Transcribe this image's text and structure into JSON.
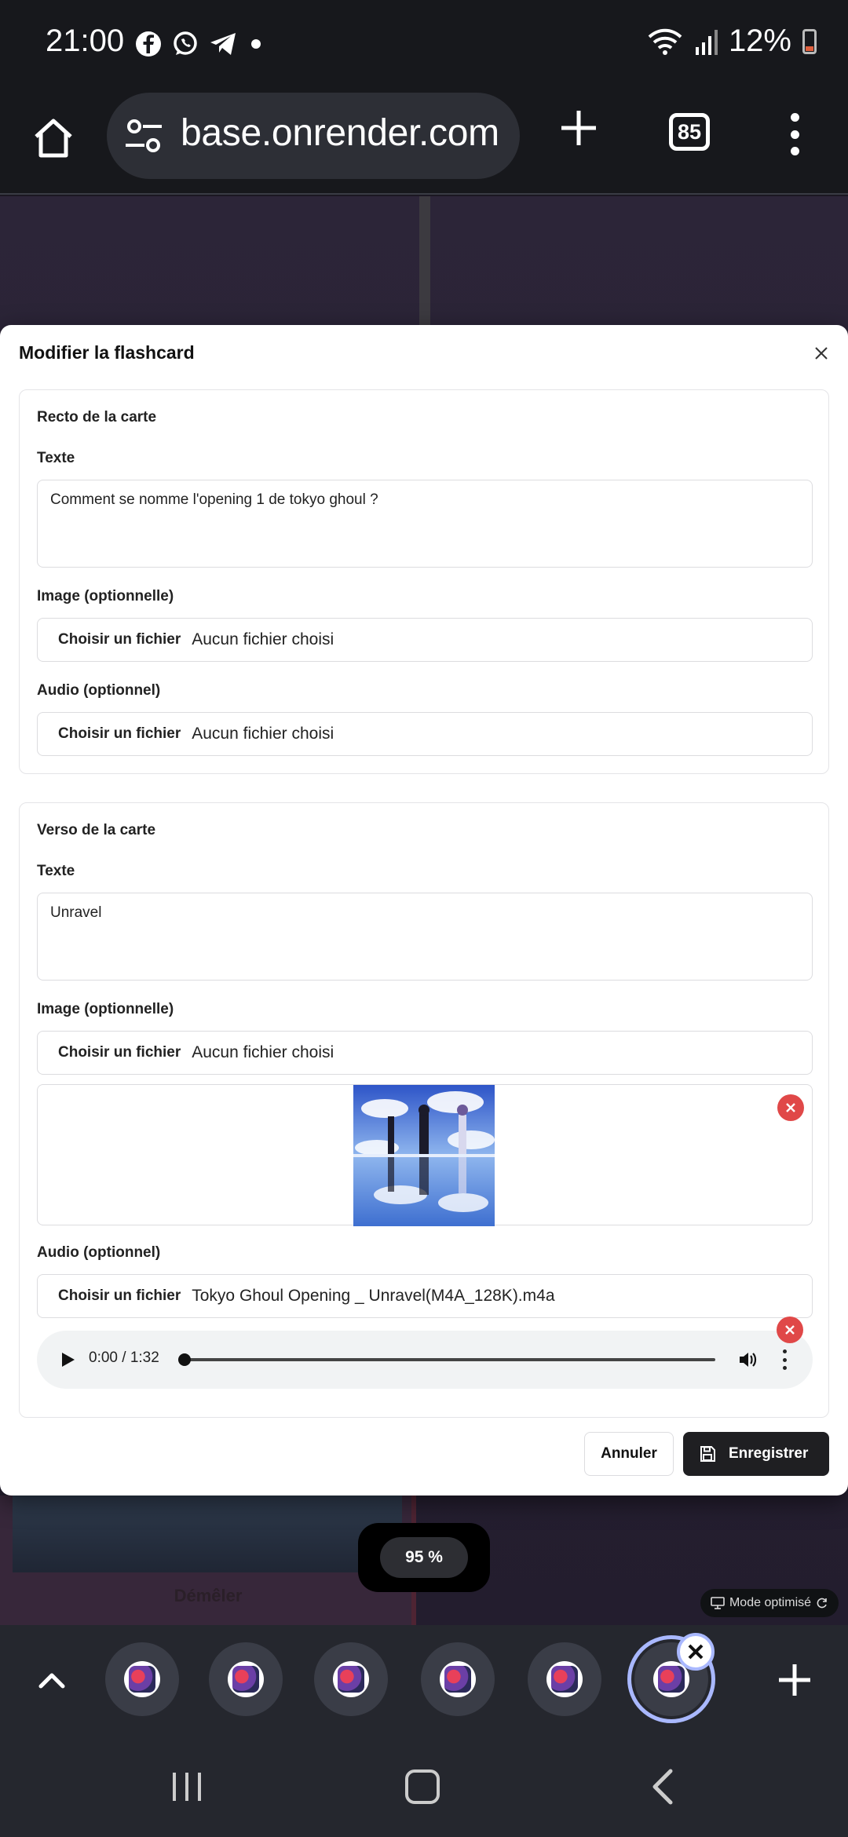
{
  "status_bar": {
    "time": "21:00",
    "icons": [
      "facebook-icon",
      "whatsapp-icon",
      "telegram-icon",
      "dot-icon"
    ],
    "battery": "12%"
  },
  "browser": {
    "url": "base.onrender.com",
    "tab_count": "85"
  },
  "modal": {
    "title": "Modifier la flashcard",
    "front": {
      "title": "Recto de la carte",
      "text_label": "Texte",
      "text_value": "Comment se nomme l'opening 1 de tokyo ghoul ?",
      "image_label": "Image (optionnelle)",
      "image_button": "Choisir un fichier",
      "image_file": "Aucun fichier choisi",
      "audio_label": "Audio (optionnel)",
      "audio_button": "Choisir un fichier",
      "audio_file": "Aucun fichier choisi"
    },
    "back": {
      "title": "Verso de la carte",
      "text_label": "Texte",
      "text_value": "Unravel",
      "image_label": "Image (optionnelle)",
      "image_button": "Choisir un fichier",
      "image_file": "Aucun fichier choisi",
      "audio_label": "Audio (optionnel)",
      "audio_button": "Choisir un fichier",
      "audio_file": "Tokyo Ghoul Opening _ Unravel(M4A_128K).m4a",
      "audio_time": "0:00 / 1:32",
      "audio_progress": 0
    },
    "cancel_label": "Annuler",
    "save_label": "Enregistrer"
  },
  "background_page": {
    "card_label": "Démêler",
    "zoom": "95 %",
    "mode_chip": "Mode optimisé"
  },
  "colors": {
    "accent_dark": "#1f1f22",
    "remove_red": "#e04848",
    "active_tab_ring": "#a9b8ff"
  }
}
